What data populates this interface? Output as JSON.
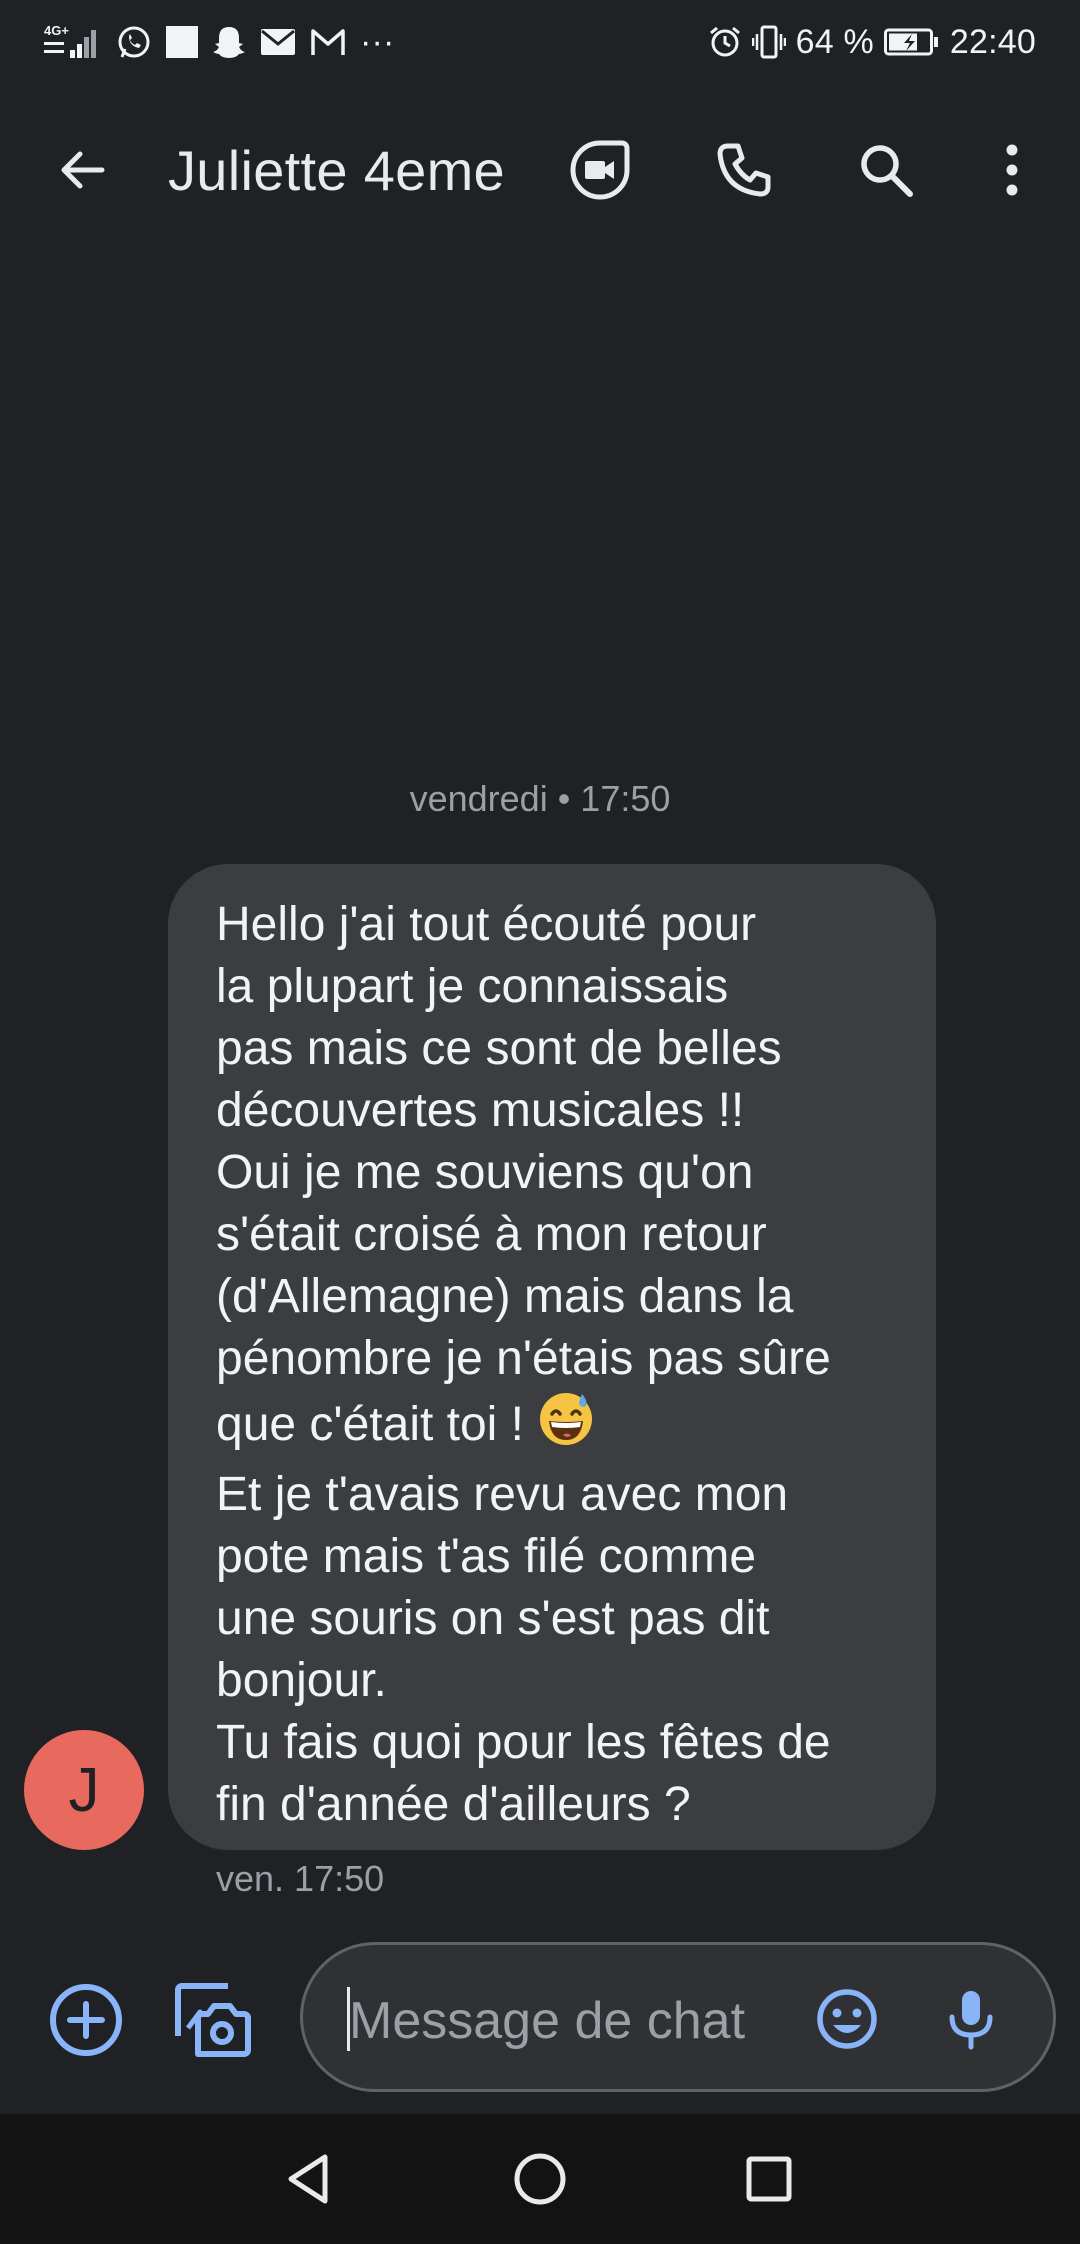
{
  "status_bar": {
    "network": "4G+",
    "battery_percent": "64 %",
    "time": "22:40",
    "overflow": "···",
    "notification_icons": [
      "whatsapp-icon",
      "square-notification-icon",
      "snapchat-icon",
      "mail-icon",
      "gmail-icon"
    ]
  },
  "app_bar": {
    "title": "Juliette 4eme",
    "actions": [
      "video-call-icon",
      "phone-icon",
      "search-icon",
      "more-vert-icon"
    ]
  },
  "conversation": {
    "date_separator": "vendredi • 17:50",
    "contact_initial": "J",
    "messages": [
      {
        "text_before_emoji": "Hello j'ai tout écouté pour\nla plupart je connaissais\npas mais ce sont de belles\ndécouvertes musicales !!\nOui je me souviens qu'on\ns'était croisé à mon retour\n(d'Allemagne) mais dans la\npénombre je n'étais pas sûre\nque c'était toi ! ",
        "emoji": "grinning-sweat-emoji",
        "text_after_emoji": "\nEt je t'avais revu avec mon\npote mais t'as filé comme\nune souris on s'est pas dit\nbonjour.\nTu fais quoi pour les fêtes de\nfin d'année d'ailleurs ?",
        "timestamp": "ven. 17:50"
      }
    ]
  },
  "compose": {
    "placeholder": "Message de chat"
  },
  "colors": {
    "background": "#202124",
    "bubble": "#3c3d40",
    "avatar": "#e8695e",
    "accent": "#8ab4f8"
  }
}
